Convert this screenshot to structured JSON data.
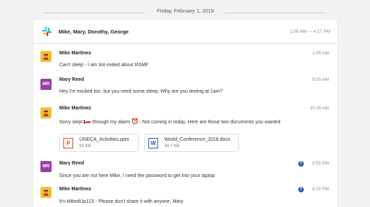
{
  "date_label": "Friday, February 1, 2019",
  "header": {
    "participants": "Mike, Mary, Dorothy, George",
    "time_range": "1:05 AM — 4:17 PM"
  },
  "messages": [
    {
      "sender": "Mike Martinez",
      "time": "1:05 AM",
      "text": "Can't sleep - I am too exited about RSMF"
    },
    {
      "sender": "Mary Reed",
      "avatar": "MR",
      "time": "8:05 AM",
      "text": "Hey I'm excited too, but you need some sleep. Why are you texting at 1am?"
    },
    {
      "sender": "Mike Martinez",
      "time": "10:25 AM",
      "text_a": "Sorry slept",
      "text_b": "through my alarm",
      "text_c": "- Not coming in today. Here are those two documents you wanted"
    },
    {
      "sender": "Mary Reed",
      "avatar": "MR",
      "time": "3:55 PM",
      "text": "Since you are not here Mike, I need the password to get into your laptop"
    },
    {
      "sender": "Mike Martinez",
      "time": "4:15 PM",
      "text": "It's MikedUp123 - Please don't share it with anyone, Mary"
    }
  ],
  "attachments": [
    {
      "name": "UNECA_Activities.pptx",
      "size": "92 KB",
      "icon": "P"
    },
    {
      "name": "World_Conference_2018.docx",
      "size": "30.7 KB",
      "icon": "W"
    }
  ],
  "colors": {
    "mary_avatar": "#9b3fa8",
    "mike_avatar": "#f2c037",
    "help_icon": "#2d5ea8"
  }
}
